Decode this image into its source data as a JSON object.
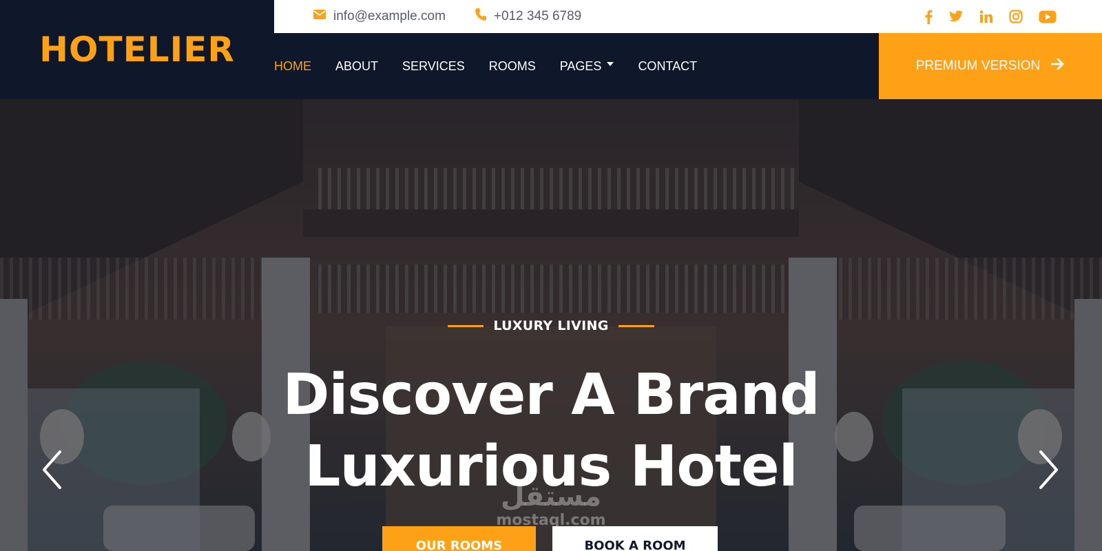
{
  "brand": {
    "name": "HOTELIER"
  },
  "topbar": {
    "email": "info@example.com",
    "phone": "+012 345 6789",
    "socials": [
      {
        "icon": "facebook-icon"
      },
      {
        "icon": "twitter-icon"
      },
      {
        "icon": "linkedin-icon"
      },
      {
        "icon": "instagram-icon"
      },
      {
        "icon": "youtube-icon"
      }
    ]
  },
  "nav": {
    "items": [
      {
        "label": "HOME",
        "active": true
      },
      {
        "label": "ABOUT"
      },
      {
        "label": "SERVICES"
      },
      {
        "label": "ROOMS"
      },
      {
        "label": "PAGES",
        "dropdown": true
      },
      {
        "label": "CONTACT"
      }
    ],
    "premium_label": "PREMIUM VERSION"
  },
  "hero": {
    "eyebrow": "LUXURY LIVING",
    "headline_line1": "Discover A Brand",
    "headline_line2": "Luxurious Hotel",
    "primary_button": "OUR ROOMS",
    "secondary_button": "BOOK A ROOM",
    "prev_icon": "chevron-left-icon",
    "next_icon": "chevron-right-icon"
  },
  "watermark": {
    "logo": "مستقل",
    "text": "mostaql.com"
  },
  "colors": {
    "accent": "#fea116",
    "dark": "#0f172b",
    "white": "#ffffff"
  }
}
